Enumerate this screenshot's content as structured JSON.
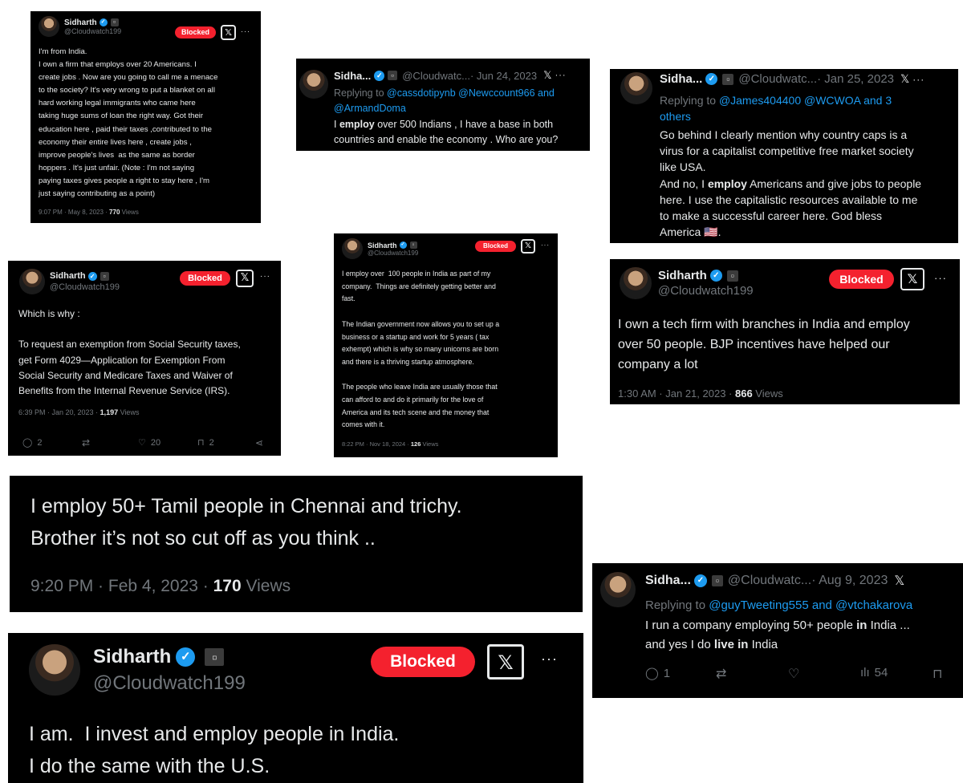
{
  "colors": {
    "background": "#ffffff",
    "tweet_bg": "#000000",
    "blocked": "#f4212e",
    "link": "#1d9bf0",
    "muted": "#71767b",
    "text": "#e7e9ea"
  },
  "tweets": [
    {
      "name": "Sidharth",
      "handle": "@Cloudwatch199",
      "blocked_label": "Blocked",
      "text": "I'm from India.\nI own a firm that employs over 20 Americans. I\ncreate jobs . Now are you going to call me a menace\nto the society? It's very wrong to put a blanket on all\nhard working legal immigrants who came here\ntaking huge sums of loan the right way. Got their\neducation here , paid their taxes ,contributed to the\neconomy their entire lives here , create jobs ,\nimprove people's lives  as the same as border\nhoppers . It's just unfair. (Note : I'm not saying\npaying taxes gives people a right to stay here , I'm\njust saying contributing as a point)",
      "time": "9:07 PM · May 8, 2023 · ",
      "views_count": "770",
      "views_label": " Views"
    },
    {
      "name": "Sidha...",
      "handle": "@Cloudwatc...",
      "date": " · Jun 24, 2023",
      "reply_prefix": "Replying to ",
      "reply_to": "@cassdotipynb @Newccount966 and\n@ArmandDoma",
      "text_before": "I ",
      "text_bold": "employ",
      "text_after": " over 500 Indians , I have a base in both\ncountries and enable the economy . Who are you?"
    },
    {
      "name": "Sidha...",
      "handle": "@Cloudwatc...",
      "date": " · Jan 25, 2023",
      "reply_prefix": "Replying to ",
      "reply_to": "@James404400 @WCWOA and 3\nothers",
      "text_before": "Go behind I clearly mention why country caps is a\nvirus for a capitalist competitive free market society\nlike USA.\nAnd no, I ",
      "text_bold": "employ",
      "text_after": " Americans and give jobs to people\nhere. I use the capitalistic resources available to me\nto make a successful career here. God bless\nAmerica 🇺🇸."
    },
    {
      "name": "Sidharth",
      "handle": "@Cloudwatch199",
      "blocked_label": "Blocked",
      "text": "Which is why :\n\nTo request an exemption from Social Security taxes,\nget Form 4029—Application for Exemption From\nSocial Security and Medicare Taxes and Waiver of\nBenefits from the Internal Revenue Service (IRS).",
      "time": "6:39 PM · Jan 20, 2023 · ",
      "views_count": "1,197",
      "views_label": " Views",
      "replies": "2",
      "likes": "20",
      "bookmarks": "2"
    },
    {
      "name": "Sidharth",
      "handle": "@Cloudwatch199",
      "blocked_label": "Blocked",
      "text": "I employ over  100 people in India as part of my\ncompany.  Things are definitely getting better and\nfast.\n\nThe Indian government now allows you to set up a\nbusiness or a startup and work for 5 years ( tax\nexhempt) which is why so many unicorns are born\nand there is a thriving startup atmosphere.\n\nThe people who leave India are usually those that\ncan afford to and do it primarily for the love of\nAmerica and its tech scene and the money that\ncomes with it.",
      "time": "8:22 PM · Nov 18, 2024 · ",
      "views_count": "126",
      "views_label": " Views"
    },
    {
      "name": "Sidharth",
      "handle": "@Cloudwatch199",
      "blocked_label": "Blocked",
      "text": "I own a tech firm with branches in India and employ\nover 50 people. BJP incentives have helped our\ncompany a lot",
      "time": "1:30 AM · Jan 21, 2023 · ",
      "views_count": "866",
      "views_label": " Views"
    },
    {
      "text": "I employ 50+ Tamil people in Chennai and trichy.\nBrother it’s not so cut off as you think ..",
      "time": "9:20 PM · Feb 4, 2023 · ",
      "views_count": "170",
      "views_label": " Views"
    },
    {
      "name": "Sidha...",
      "handle": "@Cloudwatc...",
      "date": " · Aug 9, 2023",
      "reply_prefix": "Replying to ",
      "reply_to": "@guyTweeting555 and @vtchakarova",
      "text_before": "I run a company employing 50+ people ",
      "text_bold": "in",
      "text_mid": " India ...\nand yes I do ",
      "text_bold2": "live in",
      "text_after": " India",
      "replies": "1",
      "views": "54"
    },
    {
      "name": "Sidharth",
      "handle": "@Cloudwatch199",
      "blocked_label": "Blocked",
      "text": "I am.  I invest and employ people in India.\nI do the same with the U.S."
    }
  ],
  "icons": {
    "x_logo": "x-logo-icon",
    "more": "more-icon",
    "verified": "verified-icon",
    "reply": "reply-icon",
    "retweet": "retweet-icon",
    "like": "like-icon",
    "bookmark": "bookmark-icon",
    "share": "share-icon",
    "analytics": "analytics-icon"
  },
  "glyphs": {
    "verified": "✓",
    "x": "𝕏",
    "more": "···",
    "tiny": "▫"
  }
}
